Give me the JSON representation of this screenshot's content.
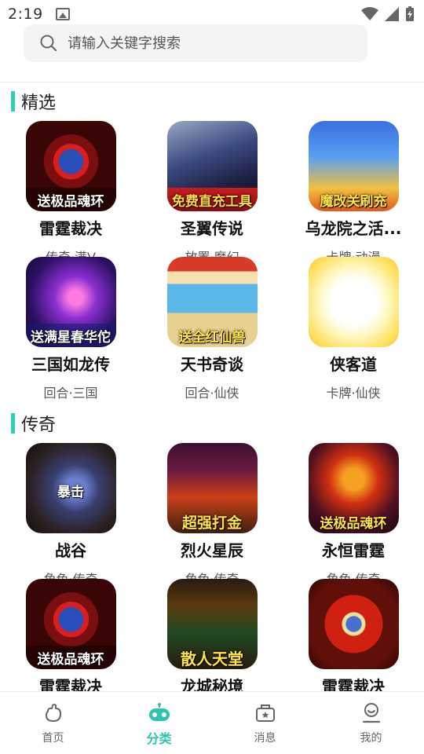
{
  "status_bar": {
    "time": "2:19"
  },
  "search": {
    "placeholder": "请输入关键字搜索"
  },
  "sections": [
    {
      "title": "精选",
      "games": [
        {
          "name": "雷霆裁决",
          "tags": "传奇·满V",
          "banner": "送极品魂环"
        },
        {
          "name": "圣翼传说",
          "tags": "放置·魔幻",
          "banner": "免费直充工具"
        },
        {
          "name": "乌龙院之活...",
          "tags": "卡牌·动漫",
          "banner": "魔改关刷充"
        },
        {
          "name": "三国如龙传",
          "tags": "回合·三国",
          "banner": "送满星春华佗"
        },
        {
          "name": "天书奇谈",
          "tags": "回合·仙侠",
          "banner": "送全红仙兽"
        },
        {
          "name": "侠客道",
          "tags": "卡牌·仙侠",
          "banner": ""
        }
      ]
    },
    {
      "title": "传奇",
      "games": [
        {
          "name": "战谷",
          "tags": "角色·传奇",
          "banner": "暴击"
        },
        {
          "name": "烈火星辰",
          "tags": "角色·传奇",
          "banner": "超强打金"
        },
        {
          "name": "永恒雷霆",
          "tags": "角色·传奇",
          "banner": "送极品魂环"
        },
        {
          "name": "雷霆裁决",
          "tags": "",
          "banner": "送极品魂环"
        },
        {
          "name": "龙城秘境",
          "tags": "",
          "banner": "散人天堂"
        },
        {
          "name": "雷霆裁决",
          "tags": "",
          "banner": ""
        }
      ]
    }
  ],
  "tabs": [
    {
      "label": "首页",
      "icon": "home-icon",
      "active": false
    },
    {
      "label": "分类",
      "icon": "gamepad-icon",
      "active": true
    },
    {
      "label": "消息",
      "icon": "message-icon",
      "active": false
    },
    {
      "label": "我的",
      "icon": "profile-icon",
      "active": false
    }
  ],
  "colors": {
    "accent": "#2fc4b0",
    "section_bar": "#2fd2b4"
  }
}
